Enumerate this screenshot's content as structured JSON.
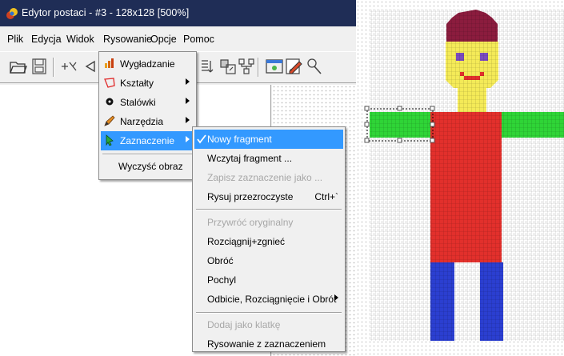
{
  "window": {
    "title": "Edytor postaci - #3 - 128x128 [500%]",
    "menubar": [
      "Plik",
      "Edycja",
      "Widok",
      "Rysowanie",
      "Opcje",
      "Pomoc"
    ]
  },
  "menu_rysowanie": {
    "items": [
      {
        "label": "Wygładzanie",
        "icon": "smoothing-icon",
        "submenu": false
      },
      {
        "label": "Kształty",
        "icon": "shape-icon",
        "submenu": true
      },
      {
        "label": "Stalówki",
        "icon": "nib-icon",
        "submenu": true
      },
      {
        "label": "Narzędzia",
        "icon": "pencil-icon",
        "submenu": true
      },
      {
        "label": "Zaznaczenie",
        "icon": "cursor-icon",
        "submenu": true,
        "highlighted": true
      },
      {
        "label": "Wyczyść obraz",
        "icon": "",
        "submenu": false
      }
    ]
  },
  "menu_zaznaczenie": {
    "items": [
      {
        "label": "Nowy fragment",
        "checked": true,
        "highlighted": true,
        "disabled": false
      },
      {
        "label": "Wczytaj fragment ...",
        "disabled": false
      },
      {
        "label": "Zapisz zaznaczenie jako ...",
        "disabled": true
      },
      {
        "label": "Rysuj przezroczyste",
        "shortcut": "Ctrl+`",
        "disabled": false
      },
      {
        "label": "Przywróć oryginalny",
        "disabled": true
      },
      {
        "label": "Rozciągnij+zgnieć",
        "disabled": false
      },
      {
        "label": "Obróć",
        "disabled": false
      },
      {
        "label": "Pochyl",
        "disabled": false
      },
      {
        "label": "Odbicie, Rozciągnięcie i Obrót",
        "submenu": true,
        "disabled": false
      },
      {
        "label": "Dodaj jako klatkę",
        "disabled": true
      },
      {
        "label": "Rysowanie z zaznaczeniem",
        "disabled": false
      }
    ]
  },
  "colors": {
    "hat": "#8b1c3e",
    "face": "#f4ea58",
    "eyes": "#7b4bbf",
    "mouth": "#e2302c",
    "body": "#e2302c",
    "arms": "#2fd437",
    "legs": "#2b3fd0",
    "highlight": "#3399ff",
    "titlebar": "#1f2d56"
  }
}
